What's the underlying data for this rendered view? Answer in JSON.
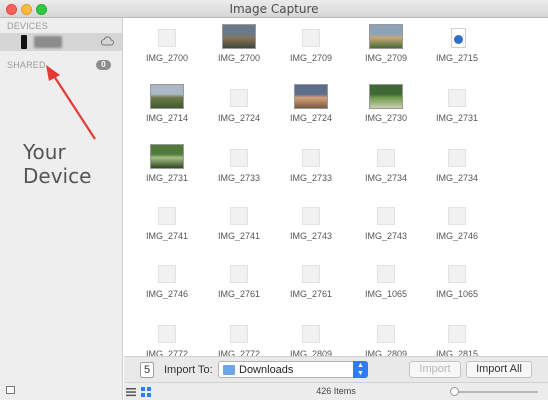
{
  "window": {
    "title": "Image Capture"
  },
  "sidebar": {
    "devices_label": "DEVICES",
    "shared_label": "SHARED",
    "shared_count": "0",
    "device": {
      "icon": "phone-icon",
      "sync_icon": "cloud-icon"
    }
  },
  "annotation": {
    "text": "Your Device",
    "color": "#e53935"
  },
  "thumbnails": [
    {
      "label": "IMG_2700",
      "kind": "blank"
    },
    {
      "label": "IMG_2700",
      "kind": "photo",
      "colors": [
        "#6a7a8a",
        "#8b7355",
        "#3d4a3a"
      ]
    },
    {
      "label": "IMG_2709",
      "kind": "blank"
    },
    {
      "label": "IMG_2709",
      "kind": "photo",
      "colors": [
        "#8fa3b8",
        "#c9a877",
        "#4a6a3a"
      ]
    },
    {
      "label": "IMG_2715",
      "kind": "doc"
    },
    {
      "label": "IMG_2714",
      "kind": "photo",
      "colors": [
        "#a9b8c4",
        "#6d7b4a",
        "#3f5a2d"
      ]
    },
    {
      "label": "IMG_2724",
      "kind": "blank"
    },
    {
      "label": "IMG_2724",
      "kind": "photo",
      "colors": [
        "#5b6f8a",
        "#d4a179",
        "#7b5b3e"
      ]
    },
    {
      "label": "IMG_2730",
      "kind": "photo",
      "colors": [
        "#3f6a35",
        "#6f9a4b",
        "#c8d0b0"
      ]
    },
    {
      "label": "IMG_2731",
      "kind": "blank"
    },
    {
      "label": "IMG_2731",
      "kind": "photo",
      "colors": [
        "#4e7b3a",
        "#a7bf86",
        "#2f4a22"
      ]
    },
    {
      "label": "IMG_2733",
      "kind": "blank"
    },
    {
      "label": "IMG_2733",
      "kind": "blank"
    },
    {
      "label": "IMG_2734",
      "kind": "blank"
    },
    {
      "label": "IMG_2734",
      "kind": "blank"
    },
    {
      "label": "IMG_2741",
      "kind": "blank"
    },
    {
      "label": "IMG_2741",
      "kind": "blank"
    },
    {
      "label": "IMG_2743",
      "kind": "blank"
    },
    {
      "label": "IMG_2743",
      "kind": "blank"
    },
    {
      "label": "IMG_2746",
      "kind": "blank"
    },
    {
      "label": "IMG_2746",
      "kind": "blank"
    },
    {
      "label": "IMG_2761",
      "kind": "blank"
    },
    {
      "label": "IMG_2761",
      "kind": "blank"
    },
    {
      "label": "IMG_1065",
      "kind": "blank"
    },
    {
      "label": "IMG_1065",
      "kind": "blank"
    },
    {
      "label": "IMG_2772",
      "kind": "blank"
    },
    {
      "label": "IMG_2772",
      "kind": "blank"
    },
    {
      "label": "IMG_2809",
      "kind": "blank"
    },
    {
      "label": "IMG_2809",
      "kind": "blank"
    },
    {
      "label": "IMG_2815",
      "kind": "blank"
    }
  ],
  "importbar": {
    "count": "5",
    "import_to_label": "Import To:",
    "destination": "Downloads",
    "import_button": "Import",
    "import_all_button": "Import All"
  },
  "statusbar": {
    "item_count": "426 Items"
  }
}
